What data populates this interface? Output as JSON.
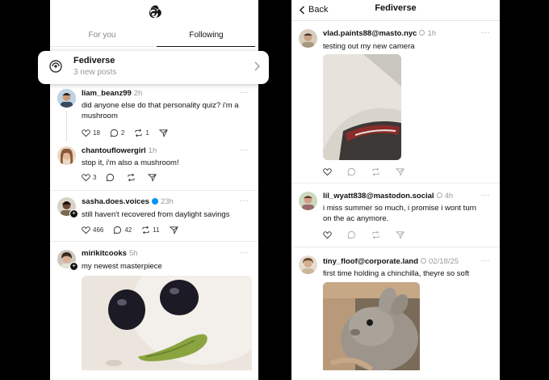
{
  "left": {
    "tabs": [
      "For you",
      "Following"
    ],
    "fediverse_card": {
      "title": "Fediverse",
      "subtitle": "3 new posts"
    },
    "posts": [
      {
        "user": "liam_beanz99",
        "time": "2h",
        "text": [
          "did anyone else do that personality quiz? i'm a",
          "mushroom"
        ],
        "likes": "18",
        "replies": "2",
        "reposts": "1"
      },
      {
        "user": "chantouflowergirl",
        "time": "1h",
        "text": [
          "stop it, i'm also a mushroom!"
        ],
        "likes": "3",
        "replies": "",
        "reposts": ""
      },
      {
        "user": "sasha.does.voices",
        "time": "23h",
        "text": [
          "still haven't recovered from daylight savings"
        ],
        "likes": "466",
        "replies": "42",
        "reposts": "11"
      },
      {
        "user": "mirikitcooks",
        "time": "5h",
        "text": [
          "my newest masterpiece"
        ]
      }
    ]
  },
  "right": {
    "back_label": "Back",
    "title": "Fediverse",
    "posts": [
      {
        "user": "vlad.paints88@masto.nyc",
        "time": "1h",
        "text": [
          "testing out my new camera"
        ]
      },
      {
        "user": "lil_wyatt838@mastodon.social",
        "time": "4h",
        "text": [
          "i miss summer so much, i promise i wont turn",
          "on the ac anymore."
        ]
      },
      {
        "user": "tiny_floof@corporate.land",
        "time": "02/18/25",
        "text": [
          "first time holding a chinchilla, theyre so soft"
        ]
      }
    ]
  },
  "colors": {
    "verified": "#0095f6",
    "muted": "#999999",
    "background": "#000000"
  },
  "more_glyph": "···"
}
